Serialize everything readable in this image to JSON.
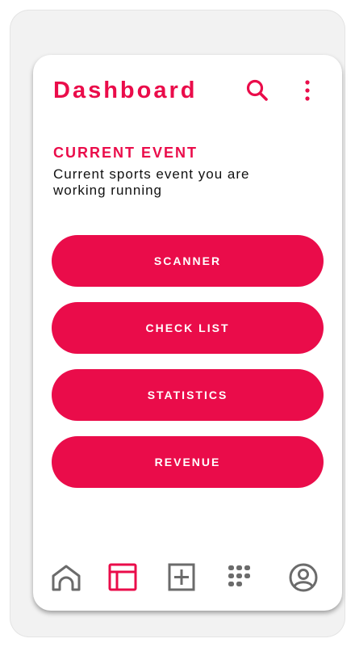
{
  "header": {
    "title": "Dashboard",
    "search_icon": "search-icon",
    "more_icon": "more-vertical-icon"
  },
  "current_event": {
    "heading": "CURRENT EVENT",
    "description": "Current sports event you are working running"
  },
  "actions": [
    {
      "label": "SCANNER"
    },
    {
      "label": "CHECK LIST"
    },
    {
      "label": "STATISTICS"
    },
    {
      "label": "REVENUE"
    }
  ],
  "bottom_nav": {
    "items": [
      {
        "icon": "home-icon",
        "active": false
      },
      {
        "icon": "dashboard-icon",
        "active": true
      },
      {
        "icon": "add-icon",
        "active": false
      },
      {
        "icon": "apps-grid-icon",
        "active": false
      },
      {
        "icon": "profile-icon",
        "active": false
      }
    ]
  },
  "colors": {
    "accent": "#ea0c4a",
    "icon_gray": "#6b6b6b",
    "text": "#111111"
  }
}
